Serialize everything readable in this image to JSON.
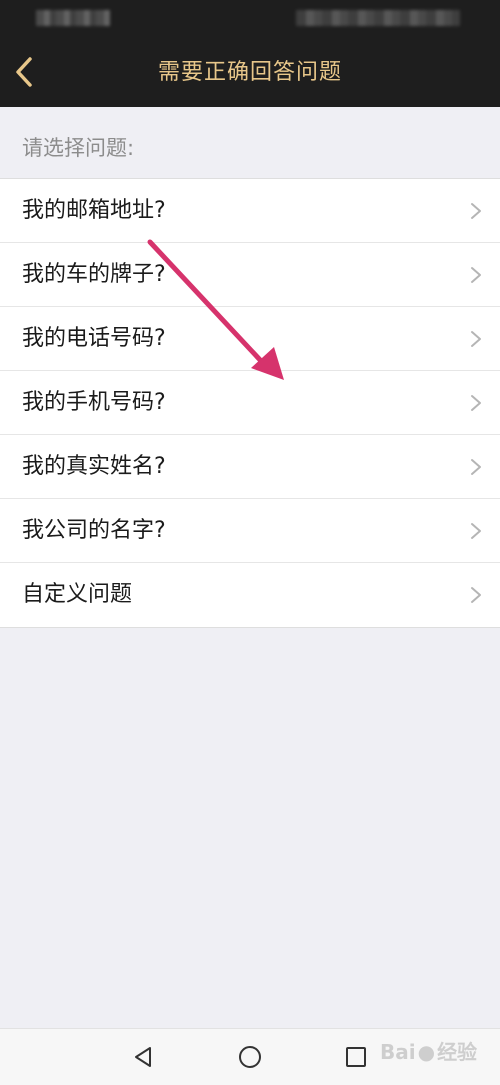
{
  "header": {
    "title": "需要正确回答问题"
  },
  "section": {
    "label": "请选择问题:"
  },
  "questions": [
    {
      "label": "我的邮箱地址?"
    },
    {
      "label": "我的车的牌子?"
    },
    {
      "label": "我的电话号码?"
    },
    {
      "label": "我的手机号码?"
    },
    {
      "label": "我的真实姓名?"
    },
    {
      "label": "我公司的名字?"
    },
    {
      "label": "自定义问题"
    }
  ],
  "watermark": {
    "text": "Bai",
    "text2": "经验"
  },
  "colors": {
    "header_bg": "#1e1e1e",
    "title": "#e8c78a",
    "back_arrow": "#e8c78a",
    "annotation_arrow": "#d6336c"
  },
  "icons": {
    "back": "back-arrow-icon",
    "row_chevron": "chevron-right-icon",
    "nav_back": "triangle-back-icon",
    "nav_home": "circle-home-icon",
    "nav_recent": "square-recent-icon"
  }
}
